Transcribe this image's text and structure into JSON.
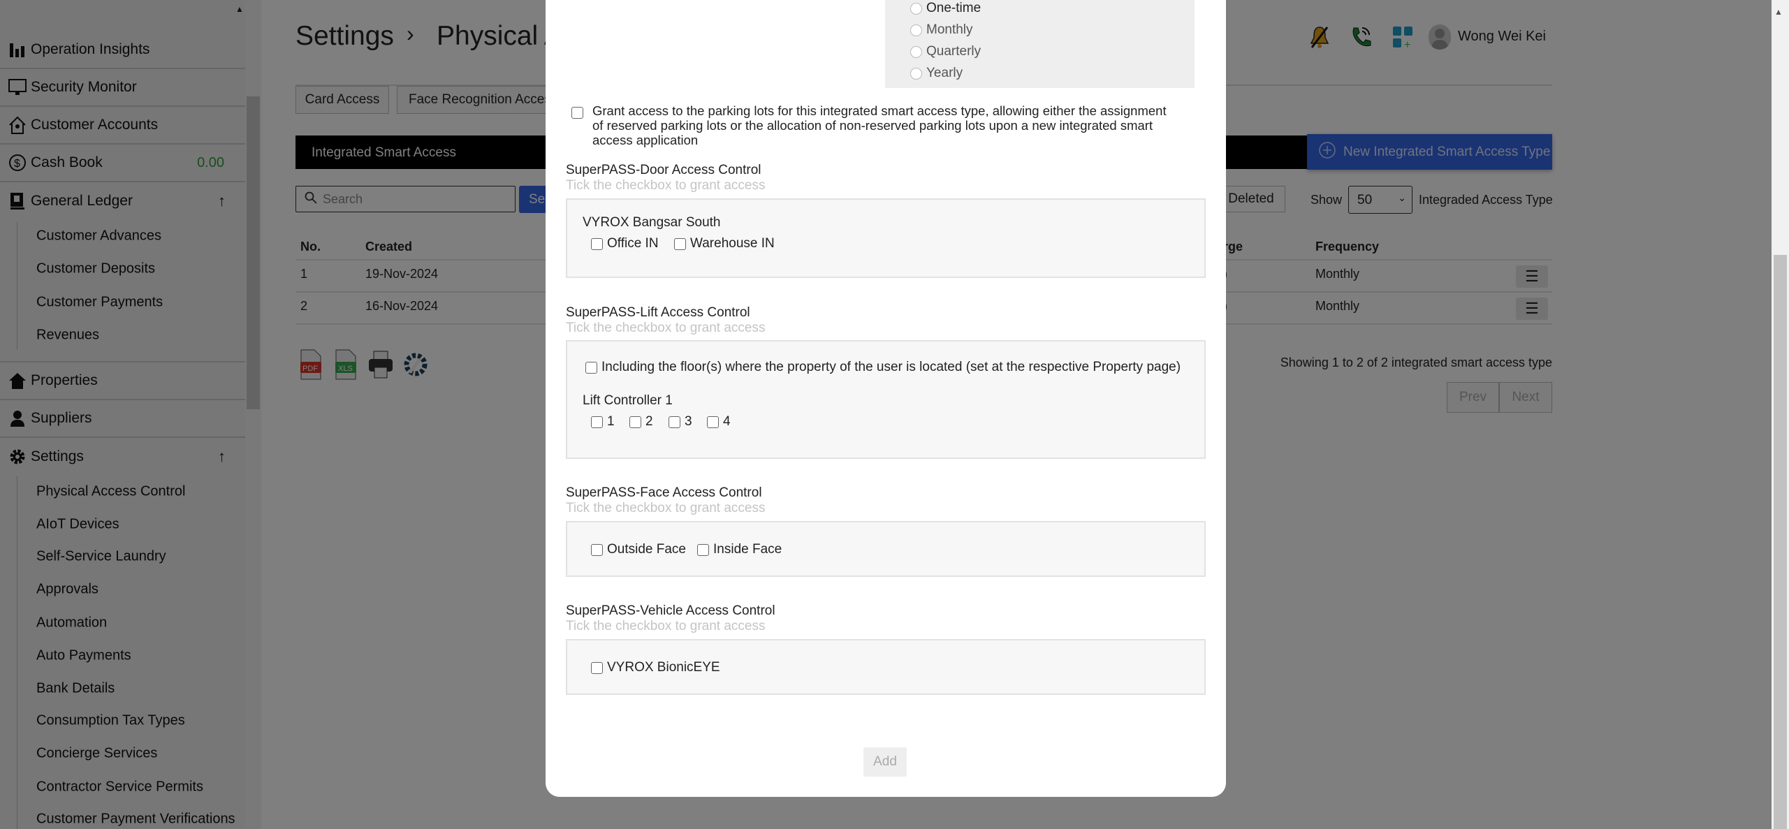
{
  "sidebar": {
    "items": [
      {
        "label": "Operation Insights",
        "icon": "bar-chart-icon"
      },
      {
        "label": "Security Monitor",
        "icon": "monitor-icon"
      },
      {
        "label": "Customer Accounts",
        "icon": "house-user-icon"
      },
      {
        "label": "Cash Book",
        "icon": "dollar-circle-icon",
        "value": "0.00"
      },
      {
        "label": "General Ledger",
        "icon": "ledger-book-icon",
        "arrow": "↑"
      },
      {
        "label": "Properties",
        "icon": "home-icon"
      },
      {
        "label": "Suppliers",
        "icon": "supplier-person-icon"
      },
      {
        "label": "Settings",
        "icon": "gear-icon",
        "arrow": "↑"
      }
    ],
    "ledger_sub": [
      "Customer Advances",
      "Customer Deposits",
      "Customer Payments",
      "Revenues"
    ],
    "settings_sub": [
      "Physical Access Control",
      "AIoT Devices",
      "Self-Service Laundry",
      "Approvals",
      "Automation",
      "Auto Payments",
      "Bank Details",
      "Consumption Tax Types",
      "Concierge Services",
      "Contractor Service Permits",
      "Customer Payment Verifications"
    ]
  },
  "header": {
    "breadcrumb_root": "Settings",
    "separator": "›",
    "breadcrumb_current": "Physical A",
    "user_name": "Wong Wei Kei",
    "icons": [
      "bell-muted-icon",
      "phone-call-icon",
      "app-grid-add-icon",
      "avatar-icon"
    ]
  },
  "tabs": [
    "Card Access",
    "Face Recognition Access"
  ],
  "section_bar": {
    "label": "Integrated Smart Access",
    "new_button": "New Integrated Smart Access Type"
  },
  "toolbar": {
    "search_placeholder": "Search",
    "search_button": "Se",
    "deleted_button": "Deleted",
    "show_label": "Show",
    "show_value": "50",
    "show_suffix": "Integraded Access Type"
  },
  "table": {
    "headers": [
      "No.",
      "Created",
      "rge",
      "Frequency"
    ],
    "rows": [
      {
        "no": "1",
        "created": "19-Nov-2024",
        "charge": ")",
        "frequency": "Monthly"
      },
      {
        "no": "2",
        "created": "16-Nov-2024",
        "charge": ")",
        "frequency": "Monthly"
      }
    ]
  },
  "export_icons": [
    "pdf-icon",
    "xls-icon",
    "printer-icon",
    "settings-wrench-icon"
  ],
  "pagination": {
    "summary": "Showing 1 to 2 of 2 integrated smart access type",
    "prev": "Prev",
    "next": "Next"
  },
  "modal": {
    "frequency_options": [
      "One-time",
      "Monthly",
      "Quarterly",
      "Yearly"
    ],
    "parking_text": "Grant access to the parking lots for this integrated smart access type, allowing either the assignment of reserved parking lots or the allocation of non-reserved parking lots upon a new integrated smart access application",
    "hint": "Tick the checkbox to grant access",
    "door": {
      "title": "SuperPASS-Door Access Control",
      "site": "VYROX Bangsar South",
      "options": [
        "Office IN",
        "Warehouse IN"
      ]
    },
    "lift": {
      "title": "SuperPASS-Lift Access Control",
      "including": "Including the floor(s) where the property of the user is located (set at the respective Property page)",
      "controller": "Lift Controller 1",
      "floors": [
        "1",
        "2",
        "3",
        "4"
      ]
    },
    "face": {
      "title": "SuperPASS-Face Access Control",
      "options": [
        "Outside Face",
        "Inside Face"
      ]
    },
    "vehicle": {
      "title": "SuperPASS-Vehicle Access Control",
      "options": [
        "VYROX BionicEYE"
      ]
    },
    "add_button": "Add"
  },
  "colors": {
    "accent_blue": "#3567e6",
    "cash_green": "#2e9e3e",
    "section_bar": "#000000"
  }
}
